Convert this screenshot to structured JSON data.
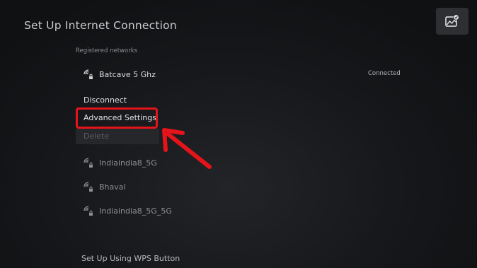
{
  "header": {
    "title": "Set Up Internet Connection",
    "top_button_icon": "image-check-icon"
  },
  "registered": {
    "label": "Registered networks",
    "network": {
      "name": "Batcave 5 Ghz",
      "status": "Connected",
      "icon": "wifi-lock-icon"
    },
    "menu": {
      "disconnect": "Disconnect",
      "advanced": "Advanced Settings",
      "delete": "Delete"
    }
  },
  "other_networks": [
    {
      "name": "Indiaindia8_5G",
      "icon": "wifi-lock-icon"
    },
    {
      "name": "Bhaval",
      "icon": "wifi-lock-icon"
    },
    {
      "name": "Indiaindia8_5G_5G",
      "icon": "wifi-lock-icon"
    }
  ],
  "footer": {
    "wps": "Set Up Using WPS Button"
  },
  "annotation": {
    "box_color": "#e4141a",
    "arrow_color": "#e4141a"
  }
}
